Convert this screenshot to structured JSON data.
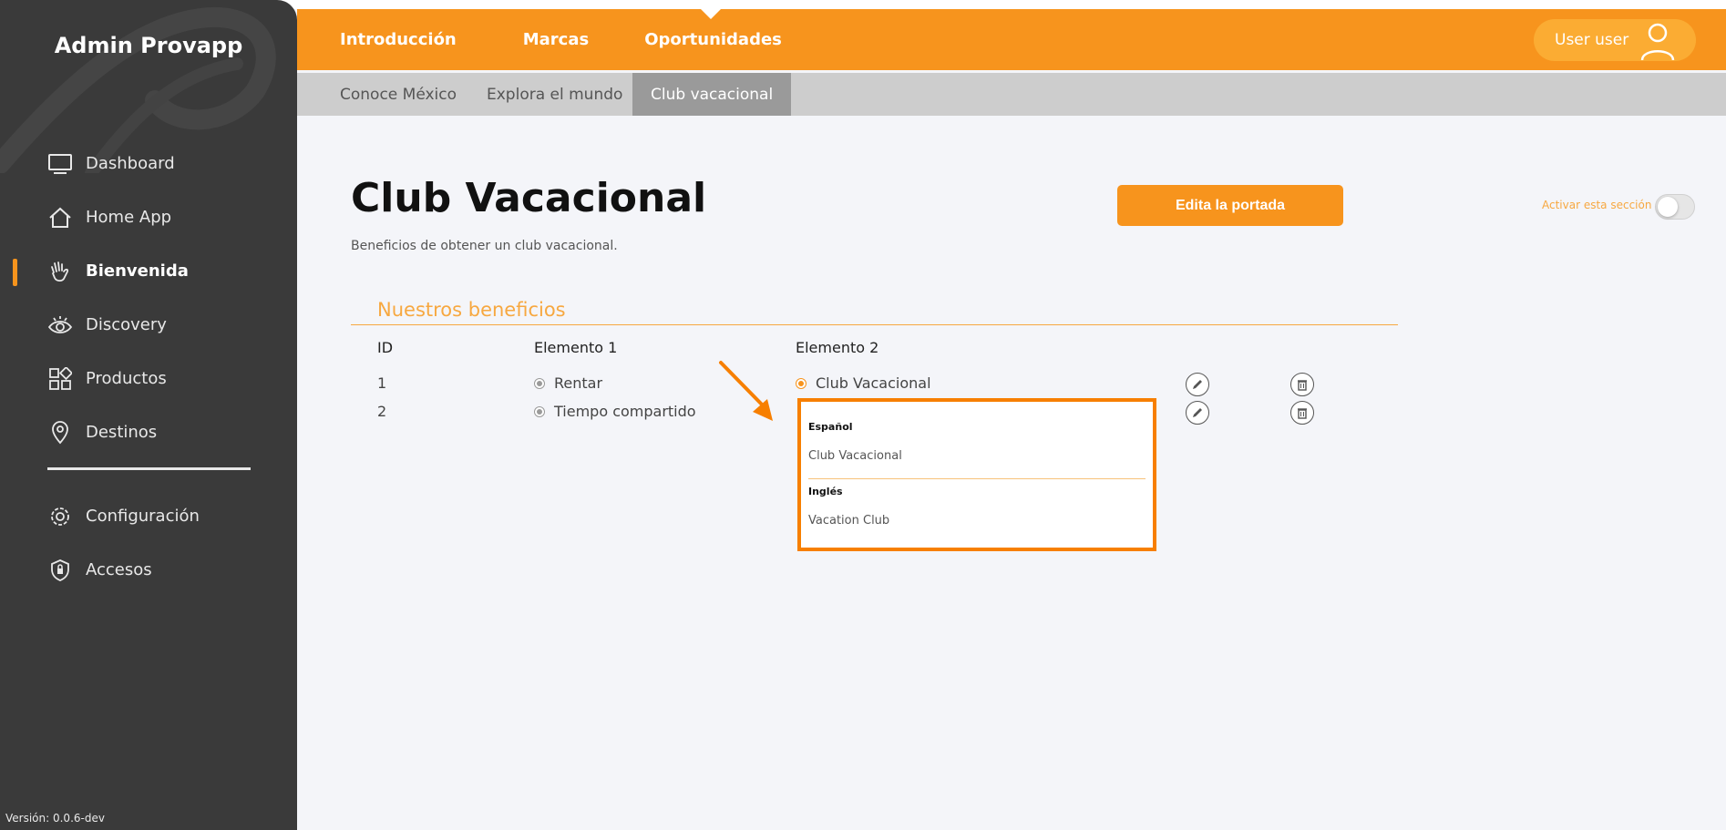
{
  "app": {
    "title": "Admin Provapp",
    "version": "Versión: 0.0.6-dev"
  },
  "sidebar": {
    "items": [
      {
        "label": "Dashboard",
        "icon": "monitor-icon"
      },
      {
        "label": "Home App",
        "icon": "home-icon"
      },
      {
        "label": "Bienvenida",
        "icon": "waving-hand-icon",
        "active": true
      },
      {
        "label": "Discovery",
        "icon": "eye-icon"
      },
      {
        "label": "Productos",
        "icon": "grid-icon"
      },
      {
        "label": "Destinos",
        "icon": "map-pin-icon"
      }
    ],
    "bottom_items": [
      {
        "label": "Configuración",
        "icon": "gear-icon"
      },
      {
        "label": "Accesos",
        "icon": "shield-lock-icon"
      }
    ]
  },
  "topnav": {
    "items": [
      "Introducción",
      "Marcas",
      "Oportunidades"
    ],
    "user": "User user"
  },
  "subtabs": {
    "items": [
      "Conoce México",
      "Explora el mundo",
      "Club vacacional"
    ],
    "active": "Club vacacional"
  },
  "main": {
    "title": "Club Vacacional",
    "description": "Beneficios de obtener un club vacacional.",
    "edit_button": "Edita la portada",
    "activate_label": "Activar esta sección",
    "section_title": "Nuestros beneficios",
    "table": {
      "headers": [
        "ID",
        "Elemento 1",
        "Elemento 2"
      ],
      "rows": [
        {
          "id": "1",
          "elemento1": "Rentar",
          "elemento2": "Club Vacacional"
        },
        {
          "id": "2",
          "elemento1": "Tiempo compartido",
          "elemento2": ""
        }
      ]
    },
    "popover": {
      "label_es": "Español",
      "value_es": "Club Vacacional",
      "label_en": "Inglés",
      "value_en": "Vacation Club"
    }
  },
  "colors": {
    "accent": "#f7941d",
    "sidebar": "#3a3a3a",
    "highlight": "#f77f00"
  }
}
